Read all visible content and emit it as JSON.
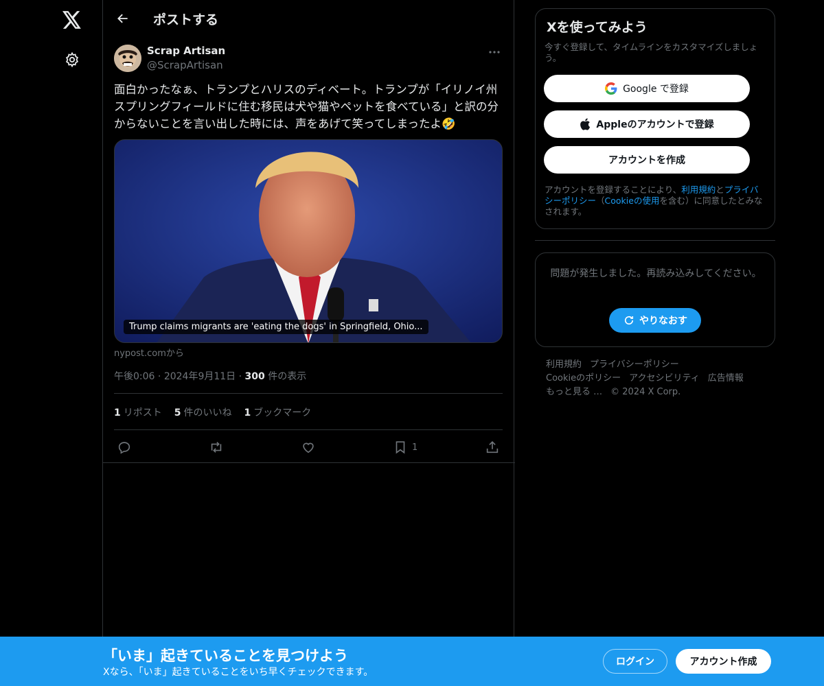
{
  "header": {
    "title": "ポストする"
  },
  "post": {
    "author_name": "Scrap Artisan",
    "author_handle": "@ScrapArtisan",
    "text": "面白かったなぁ、トランプとハリスのディベート。トランプが「イリノイ州スプリングフィールドに住む移民は犬や猫やペットを食べている」と訳の分からないことを言い出した時には、声をあげて笑ってしまったよ🤣",
    "media_caption": "Trump claims migrants are 'eating the dogs' in Springfield, Ohio...",
    "source": "nypost.comから",
    "time": "午後0:06",
    "date": "2024年9月11日",
    "views_count": "300",
    "views_label": "件の表示",
    "reposts_count": "1",
    "reposts_label": "リポスト",
    "likes_count": "5",
    "likes_label": "件のいいね",
    "bookmarks_count": "1",
    "bookmarks_label": "ブックマーク",
    "bookmark_action_count": "1"
  },
  "signup": {
    "title": "Xを使ってみよう",
    "subtitle": "今すぐ登録して、タイムラインをカスタマイズしましょう。",
    "google_label": "Google で登録",
    "apple_label": "Appleのアカウントで登録",
    "create_label": "アカウントを作成",
    "legal_prefix": "アカウントを登録することにより、",
    "legal_terms": "利用規約",
    "legal_and": "と",
    "legal_privacy": "プライバシーポリシー",
    "legal_open": "（",
    "legal_cookie": "Cookieの使用",
    "legal_suffix": "を含む）に同意したとみなされます。"
  },
  "error": {
    "message": "問題が発生しました。再読み込みしてください。",
    "retry_label": "やりなおす"
  },
  "footer": {
    "links": [
      "利用規約",
      "プライバシーポリシー",
      "Cookieのポリシー",
      "アクセシビリティ",
      "広告情報",
      "もっと見る …",
      "© 2024 X Corp."
    ]
  },
  "bottom_bar": {
    "title": "「いま」起きていることを見つけよう",
    "subtitle": "Xなら、「いま」起きていることをいち早くチェックできます。",
    "login_label": "ログイン",
    "create_label": "アカウント作成"
  },
  "colors": {
    "accent": "#1d9bf0",
    "background": "#000000",
    "border": "#2f3336",
    "muted_text": "#71767b",
    "primary_text": "#e7e9ea"
  },
  "icons": [
    "x-logo-icon",
    "gear-icon",
    "back-arrow-icon",
    "more-icon",
    "reply-icon",
    "repost-icon",
    "like-icon",
    "bookmark-icon",
    "share-icon",
    "google-icon",
    "apple-icon",
    "refresh-icon"
  ]
}
